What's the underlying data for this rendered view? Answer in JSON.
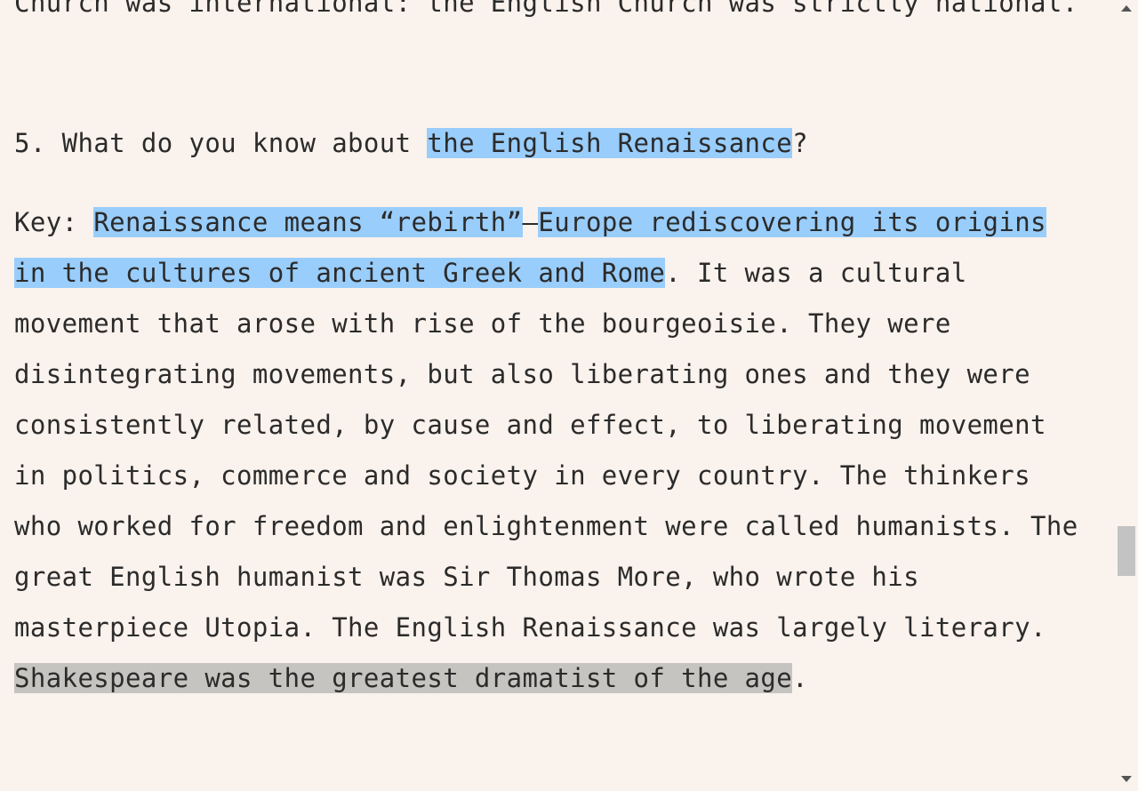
{
  "document": {
    "prev_tail": "Church was international: the English Church was strictly national.",
    "question": {
      "prefix": "5. What do you know about ",
      "highlight": "the English Renaissance",
      "suffix": "?"
    },
    "answer": {
      "line1_prefix": "Key: ",
      "line1_hl1": "Renaissance means “rebirth”",
      "line1_dash": "—",
      "line1_hl2": "Europe rediscovering its origins",
      "line2_hl": "in the cultures of ancient Greek and Rome",
      "line2_rest": ". It was a cultural",
      "line3": "movement that arose with rise of the bourgeoisie. They were",
      "line4": "disintegrating movements, but also liberating ones and they were",
      "line5": "consistently related, by cause and effect, to liberating movement",
      "line6": "in politics, commerce and society in every country. The thinkers",
      "line7": "who worked for freedom and enlightenment were called humanists. The",
      "line8": "great English humanist was Sir Thomas More, who wrote his",
      "line9": "masterpiece Utopia. The English Renaissance was largely literary.",
      "line10_hl": "Shakespeare was the greatest dramatist of the age",
      "line10_rest": "."
    }
  },
  "icons": {
    "scroll_up": "arrow-up-icon",
    "scroll_down": "arrow-down-icon"
  },
  "colors": {
    "background": "#faf2ec",
    "highlight_blue": "#99cdfb",
    "highlight_gray": "#c6c4c1"
  }
}
